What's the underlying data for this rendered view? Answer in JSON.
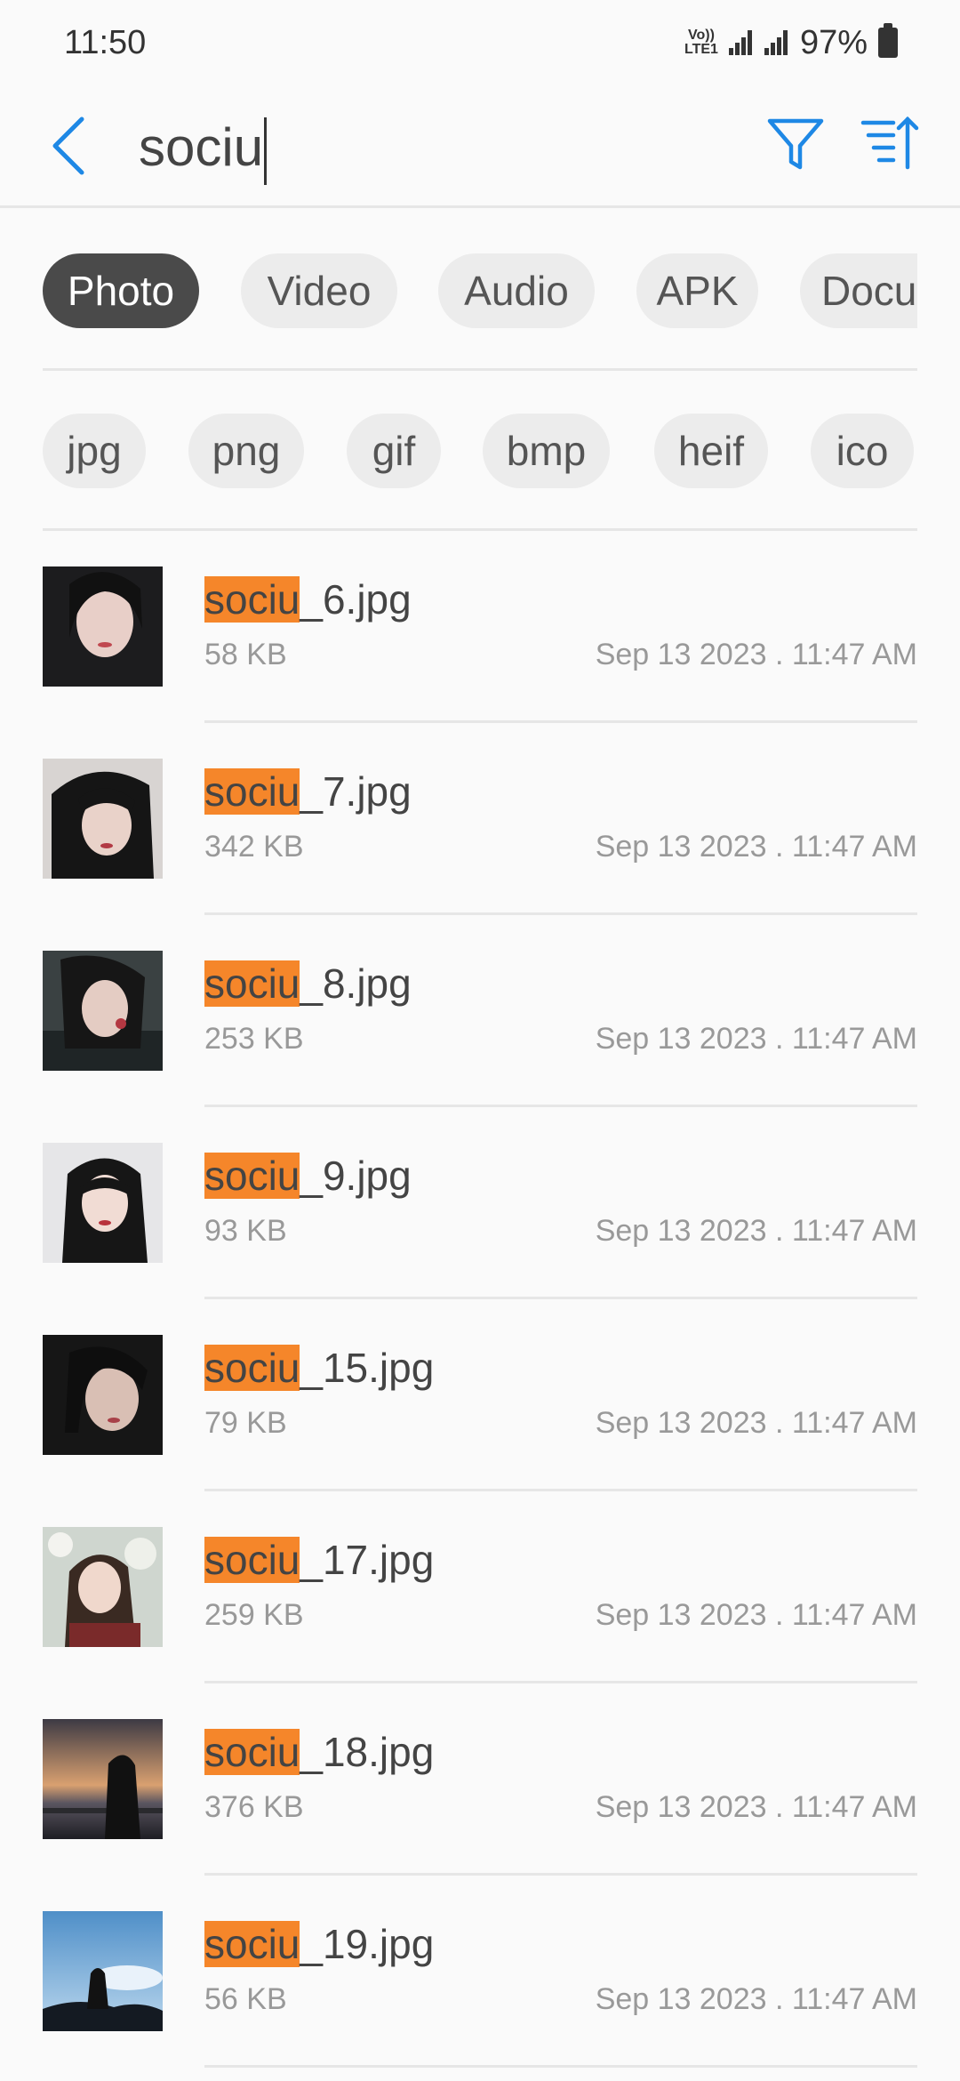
{
  "status_bar": {
    "time": "11:50",
    "volte_top": "Vo))",
    "volte_bottom": "LTE1",
    "battery": "97%"
  },
  "search": {
    "query": "sociu"
  },
  "type_filters": [
    {
      "label": "Photo",
      "active": true
    },
    {
      "label": "Video",
      "active": false
    },
    {
      "label": "Audio",
      "active": false
    },
    {
      "label": "APK",
      "active": false
    },
    {
      "label": "Docu",
      "active": false
    }
  ],
  "ext_filters": [
    "jpg",
    "png",
    "gif",
    "bmp",
    "heif",
    "ico"
  ],
  "files": [
    {
      "match": "sociu",
      "rest": "_6.jpg",
      "size": "58 KB",
      "date": "Sep 13 2023 . 11:47 AM",
      "thumb": "portrait-dark-hair-pale"
    },
    {
      "match": "sociu",
      "rest": "_7.jpg",
      "size": "342 KB",
      "date": "Sep 13 2023 . 11:47 AM",
      "thumb": "portrait-hair-clip"
    },
    {
      "match": "sociu",
      "rest": "_8.jpg",
      "size": "253 KB",
      "date": "Sep 13 2023 . 11:47 AM",
      "thumb": "portrait-blowing-kiss"
    },
    {
      "match": "sociu",
      "rest": "_9.jpg",
      "size": "93 KB",
      "date": "Sep 13 2023 . 11:47 AM",
      "thumb": "portrait-bangs-white-bg"
    },
    {
      "match": "sociu",
      "rest": "_15.jpg",
      "size": "79 KB",
      "date": "Sep 13 2023 . 11:47 AM",
      "thumb": "portrait-dark-closeup"
    },
    {
      "match": "sociu",
      "rest": "_17.jpg",
      "size": "259 KB",
      "date": "Sep 13 2023 . 11:47 AM",
      "thumb": "portrait-smiling-outdoor"
    },
    {
      "match": "sociu",
      "rest": "_18.jpg",
      "size": "376 KB",
      "date": "Sep 13 2023 . 11:47 AM",
      "thumb": "silhouette-sunset"
    },
    {
      "match": "sociu",
      "rest": "_19.jpg",
      "size": "56 KB",
      "date": "Sep 13 2023 . 11:47 AM",
      "thumb": "silhouette-sky"
    }
  ],
  "colors": {
    "accent": "#1e88e5",
    "highlight": "#f5862a",
    "chip_active": "#4a4a4a",
    "chip_bg": "#ececec"
  }
}
